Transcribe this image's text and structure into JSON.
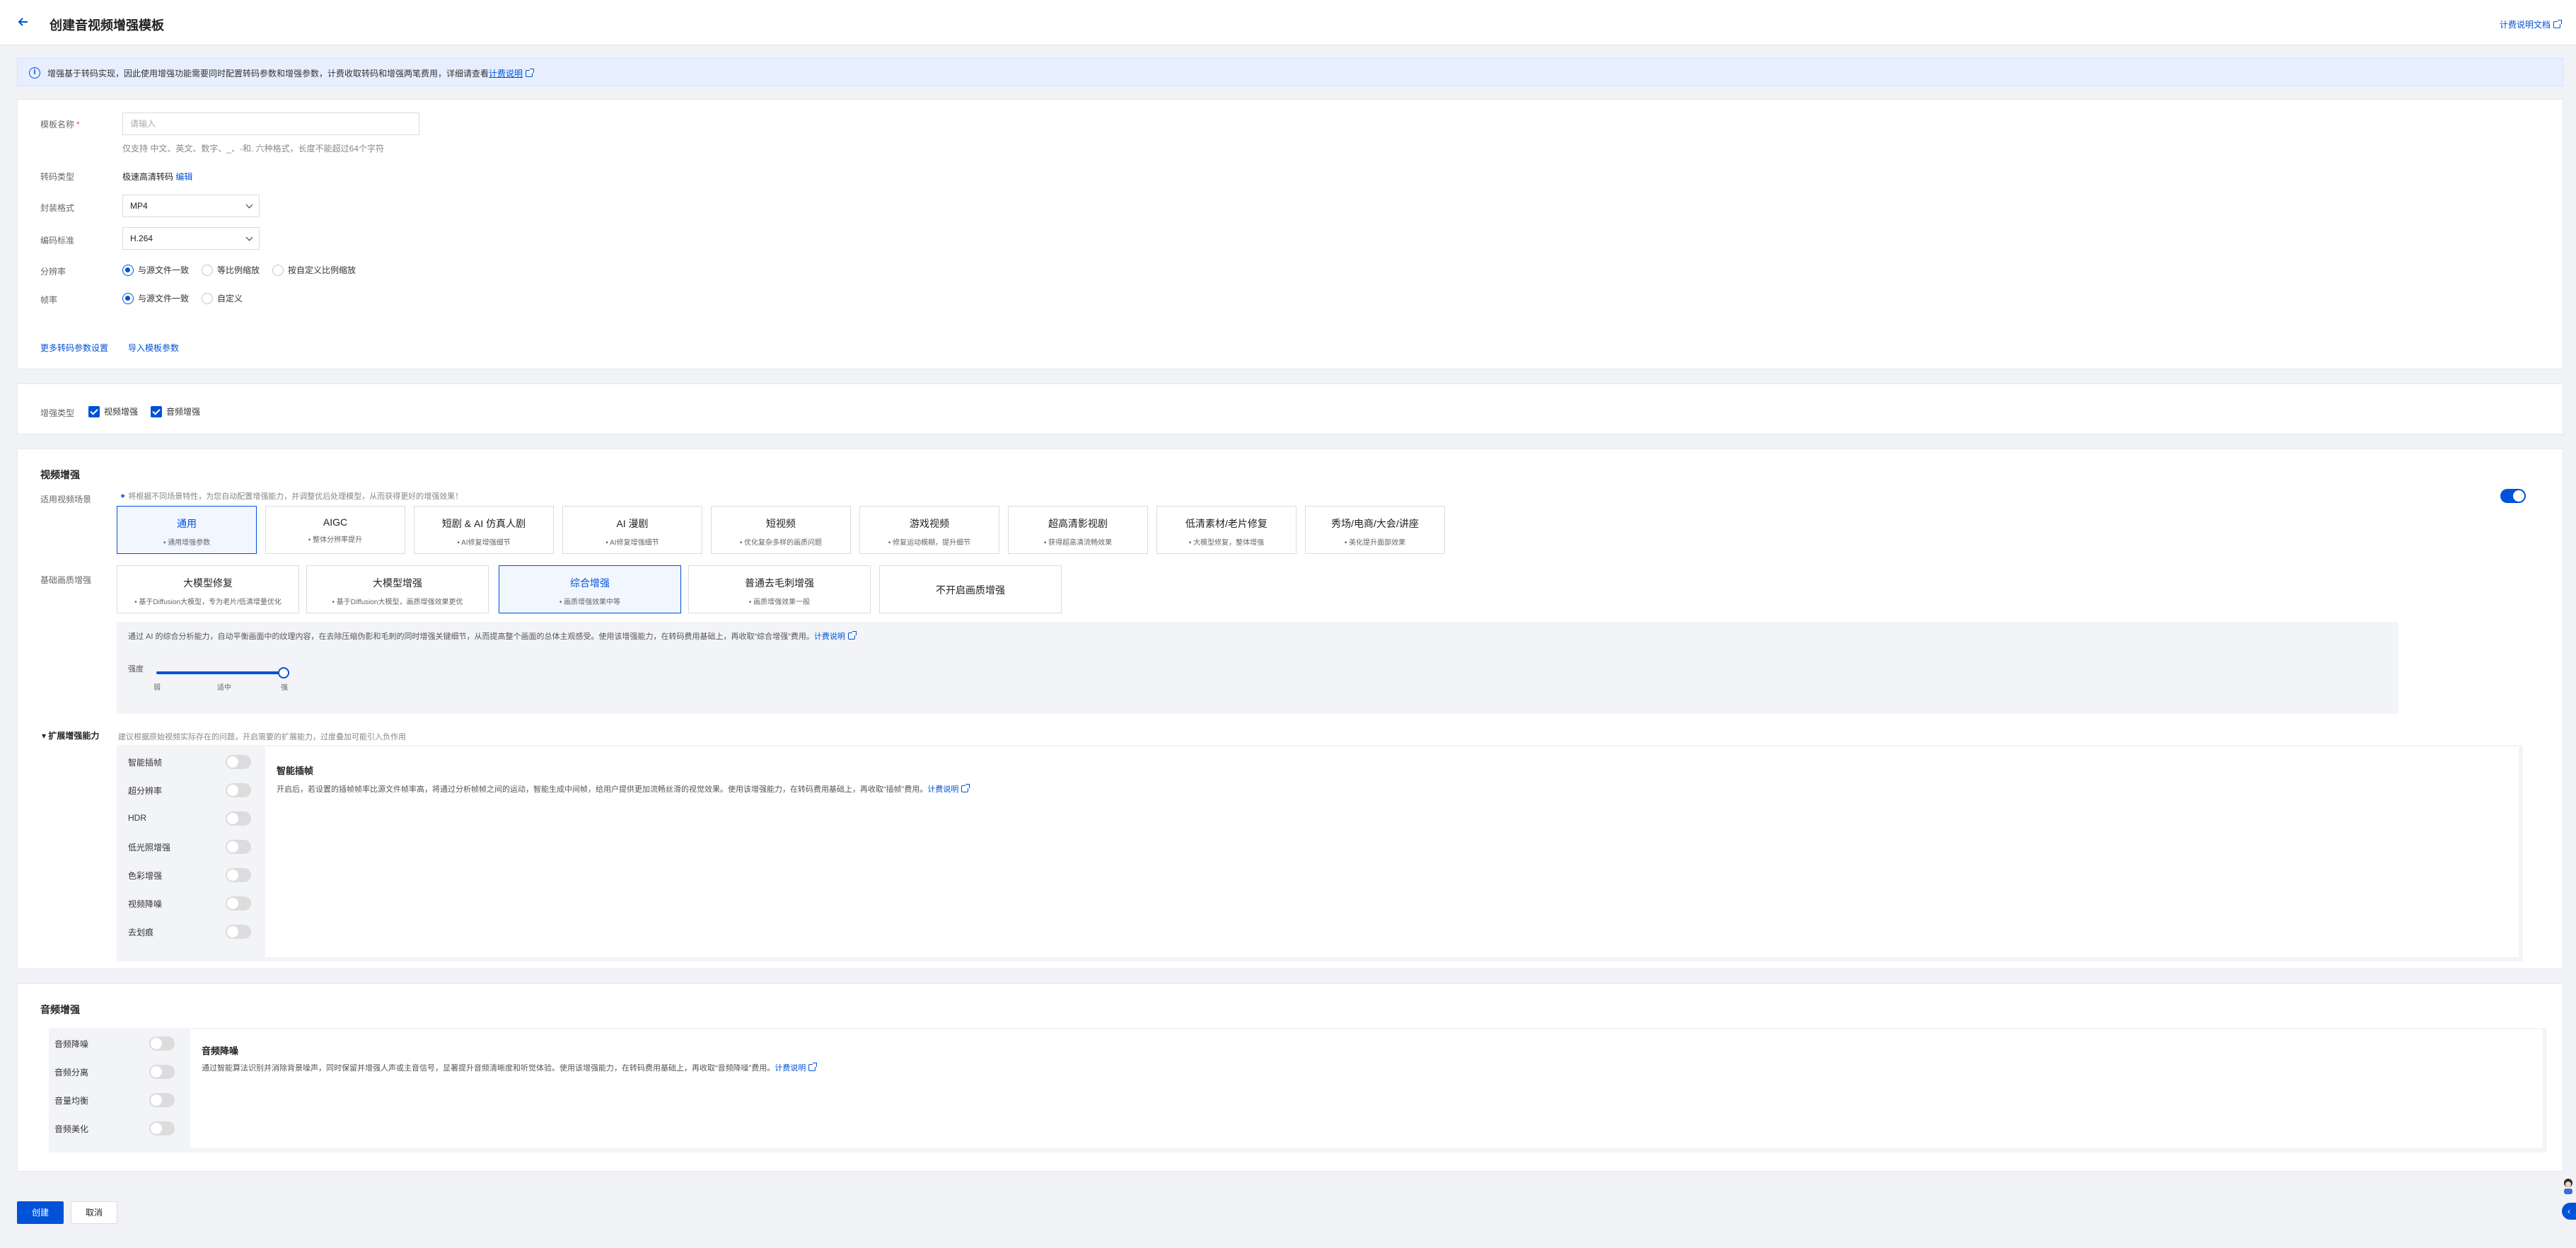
{
  "header": {
    "title": "创建音视频增强模板",
    "doc_link": "计费说明文档"
  },
  "banner": {
    "text": "增强基于转码实现，因此使用增强功能需要同时配置转码参数和增强参数，计费收取转码和增强两笔费用，详细请查看",
    "link": "计费说明"
  },
  "basic": {
    "name_label": "模板名称",
    "name_placeholder": "请输入",
    "name_hint": "仅支持 中文、英文、数字、_、-和. 六种格式，长度不能超过64个字符",
    "transcode_label": "转码类型",
    "transcode_value": "极速高清转码",
    "transcode_edit": "编辑",
    "container_label": "封装格式",
    "container_value": "MP4",
    "codec_label": "编码标准",
    "codec_value": "H.264",
    "resolution_label": "分辨率",
    "resolution_options": [
      "与源文件一致",
      "等比例缩放",
      "按自定义比例缩放"
    ],
    "resolution_selected": 0,
    "framerate_label": "帧率",
    "framerate_options": [
      "与源文件一致",
      "自定义"
    ],
    "framerate_selected": 0,
    "more_settings": "更多转码参数设置",
    "import_params": "导入模板参数"
  },
  "enhance_type": {
    "label": "增强类型",
    "options": [
      {
        "label": "视频增强",
        "checked": true
      },
      {
        "label": "音频增强",
        "checked": true
      }
    ]
  },
  "video": {
    "title": "视频增强",
    "scene_label": "适用视频场景",
    "scene_hint": "将根据不同场景特性，为您自动配置增强能力，并调整优后处理模型，从而获得更好的增强效果！",
    "master_toggle": true,
    "scenes": [
      {
        "name": "通用",
        "desc": "通用增强参数",
        "selected": true
      },
      {
        "name": "AIGC",
        "desc": "整体分辨率提升",
        "selected": false
      },
      {
        "name": "短剧 & AI 仿真人剧",
        "desc": "AI修复增强细节",
        "selected": false
      },
      {
        "name": "AI 漫剧",
        "desc": "AI修复增强细节",
        "selected": false
      },
      {
        "name": "短视频",
        "desc": "优化复杂多样的画质问题",
        "selected": false
      },
      {
        "name": "游戏视频",
        "desc": "修复运动模糊，提升细节",
        "selected": false
      },
      {
        "name": "超高清影视剧",
        "desc": "获得超高清流畅效果",
        "selected": false
      },
      {
        "name": "低清素材/老片修复",
        "desc": "大模型修复，整体增强",
        "selected": false
      },
      {
        "name": "秀场/电商/大会/讲座",
        "desc": "美化提升面部效果",
        "selected": false
      }
    ],
    "quality_label": "基础画质增强",
    "qualities": [
      {
        "name": "大模型修复",
        "desc": "基于Diffusion大模型，专为老片/低清增量优化",
        "selected": false
      },
      {
        "name": "大模型增强",
        "desc": "基于Diffusion大模型，画质增强效果更优",
        "selected": false
      },
      {
        "name": "综合增强",
        "desc": "画质增强效果中等",
        "selected": true
      },
      {
        "name": "普通去毛刺增强",
        "desc": "画质增强效果一般",
        "selected": false
      },
      {
        "name": "不开启画质增强",
        "desc": "",
        "selected": false
      }
    ],
    "quality_desc": "通过 AI 的综合分析能力，自动平衡画面中的纹理内容，在去除压缩伪影和毛刺的同时增强关键细节，从而提高整个画面的总体主观感受。使用该增强能力，在转码费用基础上，再收取“综合增强”费用。",
    "quality_desc_link": "计费说明",
    "strength_label": "强度",
    "strength_ticks": [
      "弱",
      "适中",
      "强"
    ],
    "strength_value": 1.0,
    "ext_title": "扩展增强能力",
    "ext_hint": "建议根据原始视频实际存在的问题，开启需要的扩展能力，过度叠加可能引入负作用",
    "ext_items": [
      {
        "label": "智能插帧",
        "on": false
      },
      {
        "label": "超分辨率",
        "on": false
      },
      {
        "label": "HDR",
        "on": false
      },
      {
        "label": "低光照增强",
        "on": false
      },
      {
        "label": "色彩增强",
        "on": false
      },
      {
        "label": "视频降噪",
        "on": false
      },
      {
        "label": "去划痕",
        "on": false
      }
    ],
    "ext_detail_title": "智能插帧",
    "ext_detail_desc": "开启后，若设置的插帧帧率比源文件帧率高，将通过分析帧帧之间的运动，智能生成中间帧，给用户提供更加流畅丝滑的视觉效果。使用该增强能力，在转码费用基础上，再收取“插帧”费用。",
    "ext_detail_link": "计费说明"
  },
  "audio": {
    "title": "音频增强",
    "items": [
      {
        "label": "音频降噪",
        "on": false
      },
      {
        "label": "音频分离",
        "on": false
      },
      {
        "label": "音量均衡",
        "on": false
      },
      {
        "label": "音频美化",
        "on": false
      }
    ],
    "detail_title": "音频降噪",
    "detail_desc": "通过智能算法识别并消除背景噪声，同时保留并增强人声或主音信号，显著提升音频清晰度和听觉体验。使用该增强能力，在转码费用基础上，再收取“音频降噪”费用。",
    "detail_link": "计费说明"
  },
  "footer": {
    "create": "创建",
    "cancel": "取消"
  },
  "colors": {
    "accent": "#0052d9",
    "background": "#f1f2f5",
    "banner": "#e7efff"
  }
}
